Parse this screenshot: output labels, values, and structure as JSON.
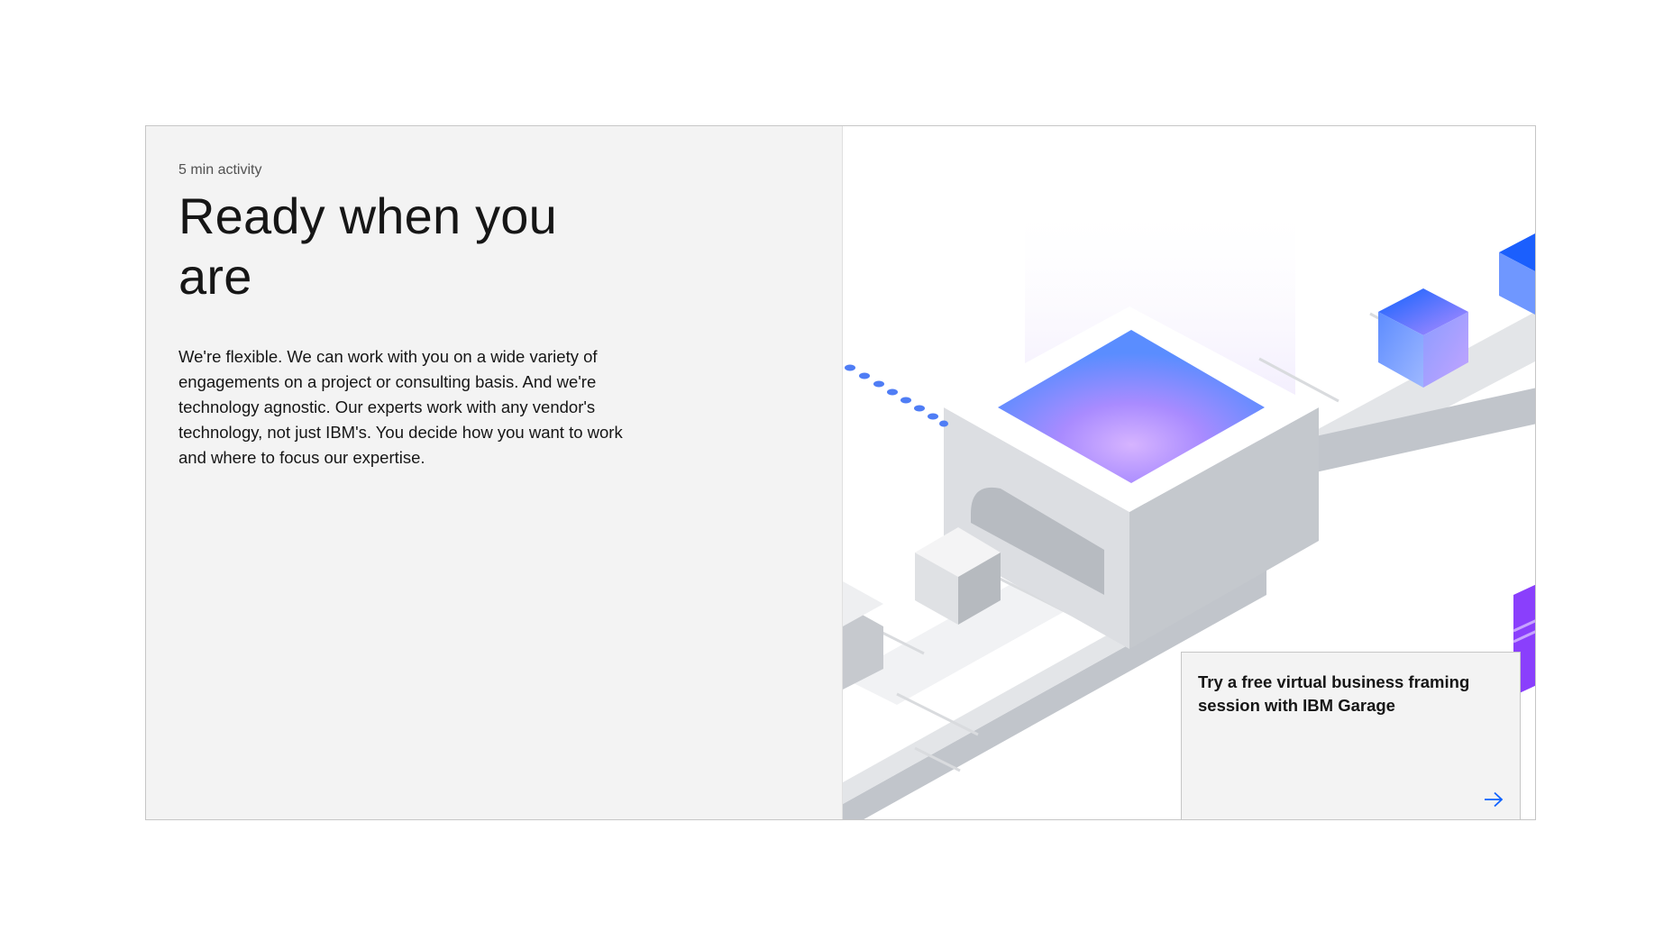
{
  "card": {
    "eyebrow": "5 min activity",
    "title": "Ready when you are",
    "body": "We're flexible. We can work with you on a wide variety of engagements on a project or consulting basis. And we're technology agnostic. Our experts work with any vendor's technology, not just IBM's. You decide how you want to work and where to focus our expertise."
  },
  "tile": {
    "text": "Try a free virtual business framing session with IBM Garage",
    "arrow_icon": "arrow-right-icon"
  },
  "colors": {
    "accent_blue": "#0f62fe",
    "panel_gray": "#f3f3f3",
    "text_primary": "#161616",
    "text_secondary": "#525252"
  }
}
